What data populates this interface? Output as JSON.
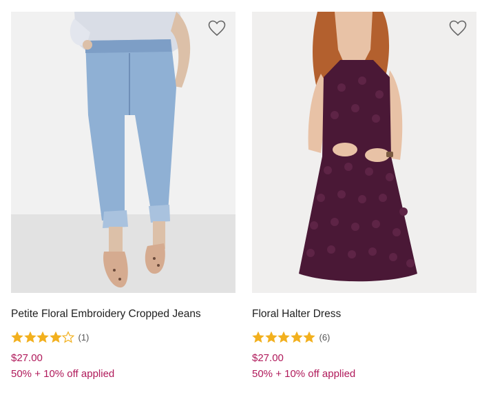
{
  "products": [
    {
      "name": "Petite Floral Embroidery Cropped Jeans",
      "rating": 4,
      "rating_max": 5,
      "review_count": "(1)",
      "price": "$27.00",
      "promo": "50% + 10% off applied",
      "image_icon": "jeans-photo"
    },
    {
      "name": "Floral Halter Dress",
      "rating": 5,
      "rating_max": 5,
      "review_count": "(6)",
      "price": "$27.00",
      "promo": "50% + 10% off applied",
      "image_icon": "dress-photo"
    }
  ],
  "colors": {
    "star": "#f2b01e",
    "price": "#b0195a",
    "denim": "#8fb0d4",
    "dress": "#4a1836"
  },
  "icons": {
    "wishlist": "heart-outline-icon",
    "star_full": "star-filled-icon",
    "star_empty": "star-outline-icon"
  }
}
